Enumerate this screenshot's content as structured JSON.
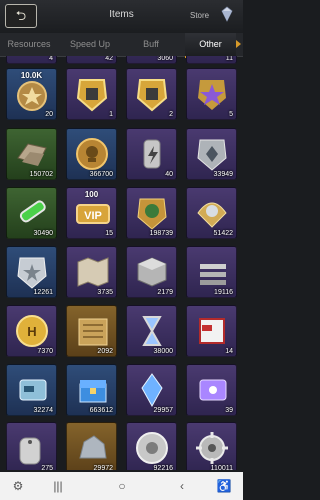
{
  "header": {
    "title": "Items",
    "back_icon": "back-arrow-icon",
    "store_label": "Store"
  },
  "tabs": [
    {
      "label": "Resources",
      "active": false
    },
    {
      "label": "Speed Up",
      "active": false
    },
    {
      "label": "Buff",
      "active": false
    },
    {
      "label": "Other",
      "active": true
    }
  ],
  "rows": [
    [
      {
        "qty": "4",
        "icon": "partial-item-icon",
        "color": "purple"
      },
      {
        "qty": "42",
        "icon": "partial-item-icon",
        "color": "purple"
      },
      {
        "qty": "3060",
        "icon": "partial-item-icon",
        "color": "purple"
      },
      {
        "qty": "11",
        "icon": "partial-item-icon",
        "color": "purple"
      }
    ],
    [
      {
        "qty": "20",
        "icon": "resource-medal-icon",
        "color": "blue",
        "label": "10.0K"
      },
      {
        "qty": "1",
        "icon": "gold-shield-badge-icon",
        "color": "purple"
      },
      {
        "qty": "2",
        "icon": "gold-shield-badge-icon",
        "color": "purple"
      },
      {
        "qty": "5",
        "icon": "purple-star-badge-icon",
        "color": "purple"
      }
    ],
    [
      {
        "qty": "150702",
        "icon": "metal-ingot-icon",
        "color": "green"
      },
      {
        "qty": "366700",
        "icon": "skull-coin-icon",
        "color": "blue"
      },
      {
        "qty": "40",
        "icon": "energy-canister-icon",
        "color": "purple"
      },
      {
        "qty": "33949",
        "icon": "silver-gem-badge-icon",
        "color": "purple"
      }
    ],
    [
      {
        "qty": "30490",
        "icon": "green-vial-icon",
        "color": "green"
      },
      {
        "qty": "15",
        "icon": "vip-token-icon",
        "color": "purple",
        "label": "100"
      },
      {
        "qty": "198739",
        "icon": "laurel-medal-icon",
        "color": "purple"
      },
      {
        "qty": "51422",
        "icon": "rank-insignia-icon",
        "color": "purple"
      }
    ],
    [
      {
        "qty": "12261",
        "icon": "silver-star-badge-icon",
        "color": "blue"
      },
      {
        "qty": "3735",
        "icon": "folded-map-icon",
        "color": "purple"
      },
      {
        "qty": "2179",
        "icon": "metal-cube-icon",
        "color": "purple"
      },
      {
        "qty": "19116",
        "icon": "steel-beams-icon",
        "color": "purple"
      }
    ],
    [
      {
        "qty": "7370",
        "icon": "gold-h-coin-icon",
        "color": "purple"
      },
      {
        "qty": "2092",
        "icon": "blueprint-scroll-icon",
        "color": "gold"
      },
      {
        "qty": "38000",
        "icon": "hourglass-icon",
        "color": "purple"
      },
      {
        "qty": "14",
        "icon": "red-document-icon",
        "color": "purple"
      }
    ],
    [
      {
        "qty": "32274",
        "icon": "supply-card-icon",
        "color": "blue"
      },
      {
        "qty": "663612",
        "icon": "blue-chest-icon",
        "color": "blue"
      },
      {
        "qty": "29957",
        "icon": "blue-crystal-icon",
        "color": "purple"
      },
      {
        "qty": "39",
        "icon": "violet-card-icon",
        "color": "purple"
      }
    ],
    [
      {
        "qty": "275",
        "icon": "dog-tag-icon",
        "color": "purple"
      },
      {
        "qty": "29972",
        "icon": "ore-rock-icon",
        "color": "gold"
      },
      {
        "qty": "92216",
        "icon": "steel-coin-icon",
        "color": "purple"
      },
      {
        "qty": "110011",
        "icon": "gear-icon",
        "color": "purple"
      }
    ]
  ],
  "navbar": {
    "items": [
      "app-switcher-icon",
      "recent-apps-icon",
      "home-icon",
      "back-icon",
      "accessibility-icon"
    ]
  }
}
